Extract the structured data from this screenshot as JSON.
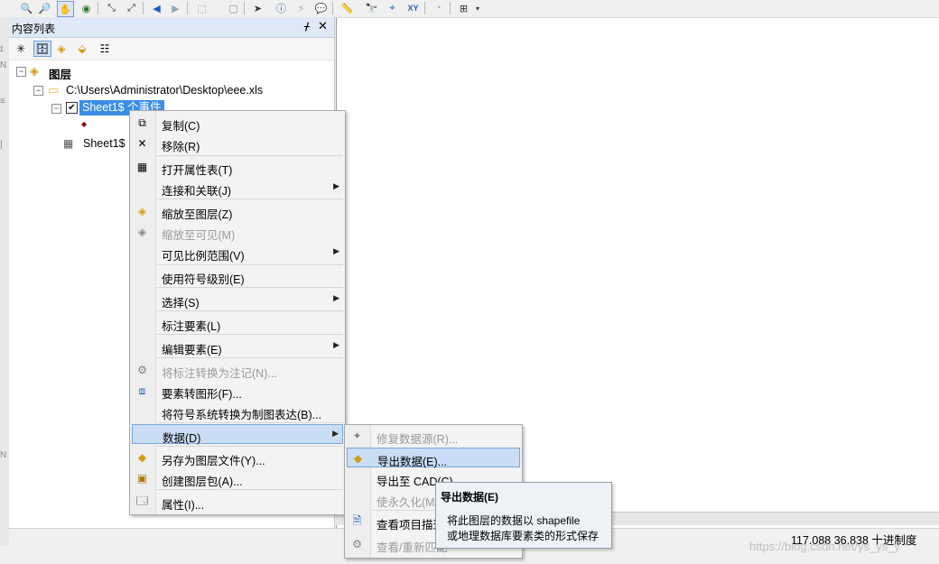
{
  "colors": {
    "selection": "#3a8ee6",
    "menu_highlight": "#c9ddf5",
    "panel_title_bg": "#dfe8f6",
    "disabled_text": "#9a9a9a"
  },
  "toolbar": {
    "icons": [
      "zoom-in-icon",
      "zoom-out-icon",
      "pan-icon",
      "globe-icon",
      "fixed-zoom-in-icon",
      "fixed-zoom-out-icon",
      "back-icon",
      "forward-icon",
      "select-features-icon",
      "clear-selection-icon",
      "select-elements-icon",
      "identify-icon",
      "hyperlink-icon",
      "html-popup-icon",
      "measure-icon",
      "find-icon",
      "find-route-icon",
      "go-to-xy-icon",
      "time-slider-icon",
      "create-viewer-icon"
    ]
  },
  "toc": {
    "title": "内容列表",
    "pin_glyph": "ᚋ",
    "close_glyph": "✕",
    "tree": {
      "root_label": "图层",
      "workspace_label": "C:\\Users\\Administrator\\Desktop\\eee.xls",
      "layer_label": "Sheet1$ 个事件",
      "table_label": "Sheet1$",
      "toggle_minus": "⊟"
    }
  },
  "context_menu": {
    "items": [
      {
        "label": "复制(C)",
        "icon": "copy-icon"
      },
      {
        "label": "移除(R)",
        "icon": "remove-icon"
      },
      {
        "label": "打开属性表(T)",
        "icon": "table-icon"
      },
      {
        "label": "连接和关联(J)",
        "submenu": true
      },
      {
        "label": "缩放至图层(Z)",
        "icon": "zoom-to-layer-icon"
      },
      {
        "label": "缩放至可见(M)",
        "icon": "zoom-to-visible-icon",
        "disabled": true
      },
      {
        "label": "可见比例范围(V)",
        "submenu": true
      },
      {
        "label": "使用符号级别(E)"
      },
      {
        "label": "选择(S)",
        "submenu": true
      },
      {
        "label": "标注要素(L)"
      },
      {
        "label": "编辑要素(E)",
        "submenu": true
      },
      {
        "label": "将标注转换为注记(N)...",
        "icon": "convert-labels-icon",
        "disabled": true
      },
      {
        "label": "要素转图形(F)...",
        "icon": "features-to-graphics-icon"
      },
      {
        "label": "将符号系统转换为制图表达(B)..."
      },
      {
        "label": "数据(D)",
        "submenu": true,
        "highlight": true
      },
      {
        "label": "另存为图层文件(Y)...",
        "icon": "layer-file-icon"
      },
      {
        "label": "创建图层包(A)...",
        "icon": "layer-package-icon"
      },
      {
        "label": "属性(I)...",
        "icon": "properties-icon"
      }
    ],
    "arrow": "▶"
  },
  "data_submenu": {
    "items": [
      {
        "label": "修复数据源(R)...",
        "icon": "repair-source-icon",
        "disabled": true
      },
      {
        "label": "导出数据(E)...",
        "icon": "export-data-icon",
        "highlight": true
      },
      {
        "label": "导出至 CAD(C)..."
      },
      {
        "label": "使永久化(M",
        "disabled": true
      },
      {
        "label": "查看项目描述",
        "icon": "item-description-icon"
      },
      {
        "label": "查看/重新匹配",
        "icon": "rematch-icon",
        "disabled": true
      }
    ]
  },
  "tooltip": {
    "title": "导出数据(E)",
    "line1": "将此图层的数据以 shapefile",
    "line2": "或地理数据库要素类的形式保存"
  },
  "status_bar": {
    "coords": "117.088  36.838 十进制度"
  },
  "watermark": "https://blog.csdn.net/ys_ys_y"
}
